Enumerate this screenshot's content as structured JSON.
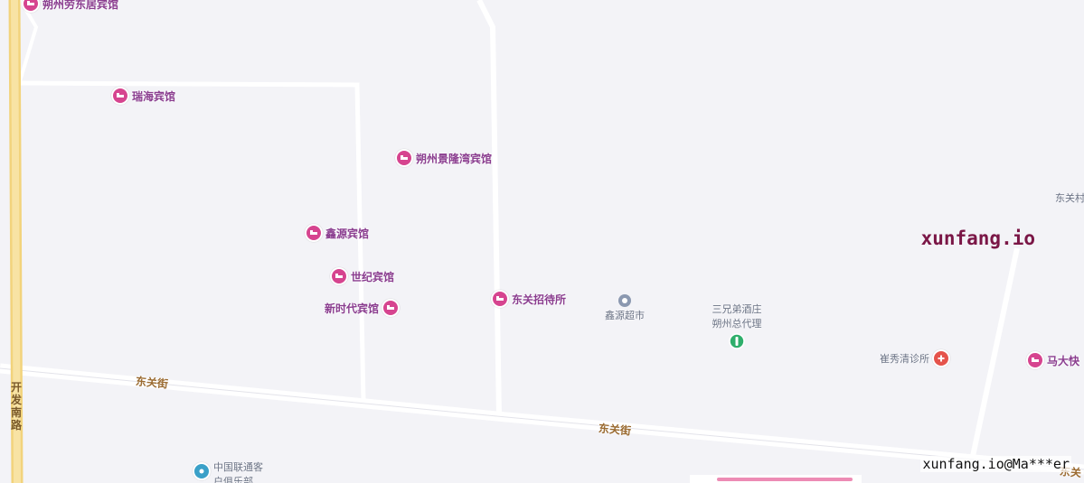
{
  "map": {
    "pois": [
      {
        "label": "朔州劳东居宾馆",
        "icon": "hotel-icon",
        "color": "#d6448f"
      },
      {
        "label": "瑞海宾馆",
        "icon": "hotel-icon",
        "color": "#d6448f"
      },
      {
        "label": "朔州景隆湾宾馆",
        "icon": "hotel-icon",
        "color": "#d6448f"
      },
      {
        "label": "鑫源宾馆",
        "icon": "hotel-icon",
        "color": "#d6448f"
      },
      {
        "label": "世纪宾馆",
        "icon": "hotel-icon",
        "color": "#d6448f"
      },
      {
        "label": "新时代宾馆",
        "icon": "hotel-icon",
        "color": "#d6448f"
      },
      {
        "label": "东关招待所",
        "icon": "hotel-icon",
        "color": "#d6448f"
      },
      {
        "label": "马大快",
        "icon": "hotel-icon",
        "color": "#d6448f"
      }
    ],
    "places": {
      "market": {
        "label": "鑫源超市",
        "icon": "location-icon"
      },
      "liquor": {
        "label_line1": "三兄弟酒庄",
        "label_line2": "朔州总代理",
        "icon": "shop-icon"
      },
      "clinic": {
        "label": "崔秀清诊所",
        "icon": "clinic-icon"
      },
      "club": {
        "label_line1": "中国联通客",
        "label_line2": "户俱乐部",
        "icon": "telecom-icon"
      }
    },
    "roads": {
      "east_street_1": "东关街",
      "east_street_2": "东关街",
      "kaifa_south": "开发南路",
      "partial_top_right": "东关村",
      "partial_bottom_right": "东关"
    },
    "watermarks": {
      "main": "xunfang.io",
      "bottom": "xunfang.io@Ma***er"
    }
  }
}
